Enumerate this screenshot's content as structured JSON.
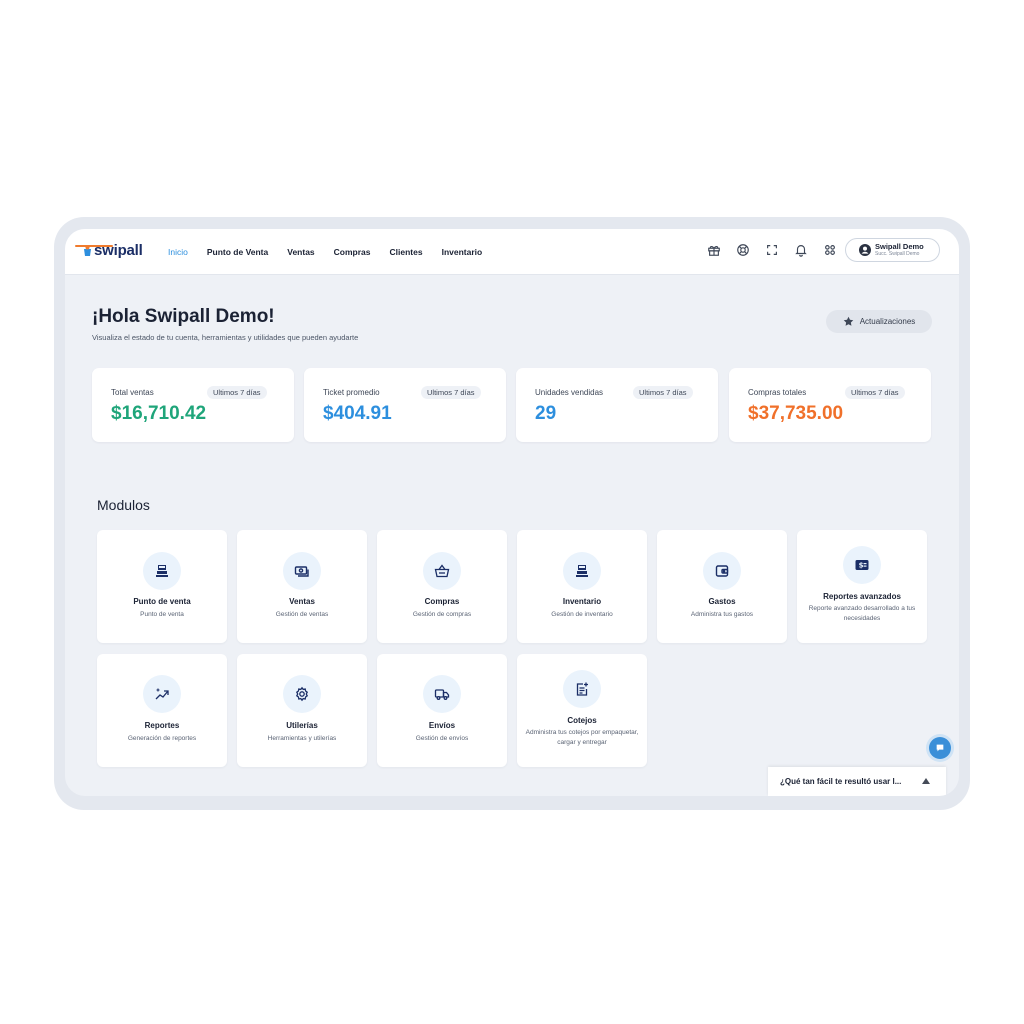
{
  "app": {
    "logo_text": "swipall",
    "brand_color": "#1b2e66",
    "accent_color": "#2d8fde"
  },
  "nav": {
    "items": [
      {
        "label": "Inicio",
        "active": true
      },
      {
        "label": "Punto de Venta"
      },
      {
        "label": "Ventas"
      },
      {
        "label": "Compras"
      },
      {
        "label": "Clientes"
      },
      {
        "label": "Inventario"
      }
    ]
  },
  "header_tools": [
    "gift-icon",
    "help-icon",
    "fullscreen-icon",
    "bell-icon",
    "apps-icon"
  ],
  "user": {
    "name": "Swipall Demo",
    "branch": "Succ. Swipall Demo"
  },
  "page": {
    "greeting": "¡Hola Swipall Demo!",
    "subtitle": "Visualiza el estado de tu cuenta, herramientas y utilidades que pueden ayudarte",
    "updates_button": "Actualizaciones"
  },
  "stats": [
    {
      "label": "Total ventas",
      "period": "Ultimos 7 días",
      "value": "$16,710.42",
      "color": "#1fa57a"
    },
    {
      "label": "Ticket promedio",
      "period": "Ultimos 7 días",
      "value": "$404.91",
      "color": "#2d8fde"
    },
    {
      "label": "Unidades vendidas",
      "period": "Ultimos 7 días",
      "value": "29",
      "color": "#2d8fde"
    },
    {
      "label": "Compras totales",
      "period": "Ultimos 7 días",
      "value": "$37,735.00",
      "color": "#f0702a"
    }
  ],
  "modules": {
    "title": "Modulos",
    "items": [
      {
        "title": "Punto de venta",
        "desc": "Punto de venta",
        "icon": "cash-register-icon"
      },
      {
        "title": "Ventas",
        "desc": "Gestión de ventas",
        "icon": "money-icon"
      },
      {
        "title": "Compras",
        "desc": "Gestión de compras",
        "icon": "basket-icon"
      },
      {
        "title": "Inventario",
        "desc": "Gestión de inventario",
        "icon": "cash-register-icon"
      },
      {
        "title": "Gastos",
        "desc": "Administra tus gastos",
        "icon": "wallet-icon"
      },
      {
        "title": "Reportes avanzados",
        "desc": "Reporte avanzado desarrollado a tus necesidades",
        "icon": "money-report-icon"
      },
      {
        "title": "Reportes",
        "desc": "Generación de reportes",
        "icon": "sparkle-chart-icon"
      },
      {
        "title": "Utilerías",
        "desc": "Herramientas y utilerías",
        "icon": "gear-icon"
      },
      {
        "title": "Envíos",
        "desc": "Gestión de envíos",
        "icon": "truck-icon"
      },
      {
        "title": "Cotejos",
        "desc": "Administra tus cotejos por empaquetar, cargar y entregar",
        "icon": "clipboard-add-icon"
      }
    ]
  },
  "survey": {
    "question": "¿Qué tan fácil te resultó usar l..."
  }
}
